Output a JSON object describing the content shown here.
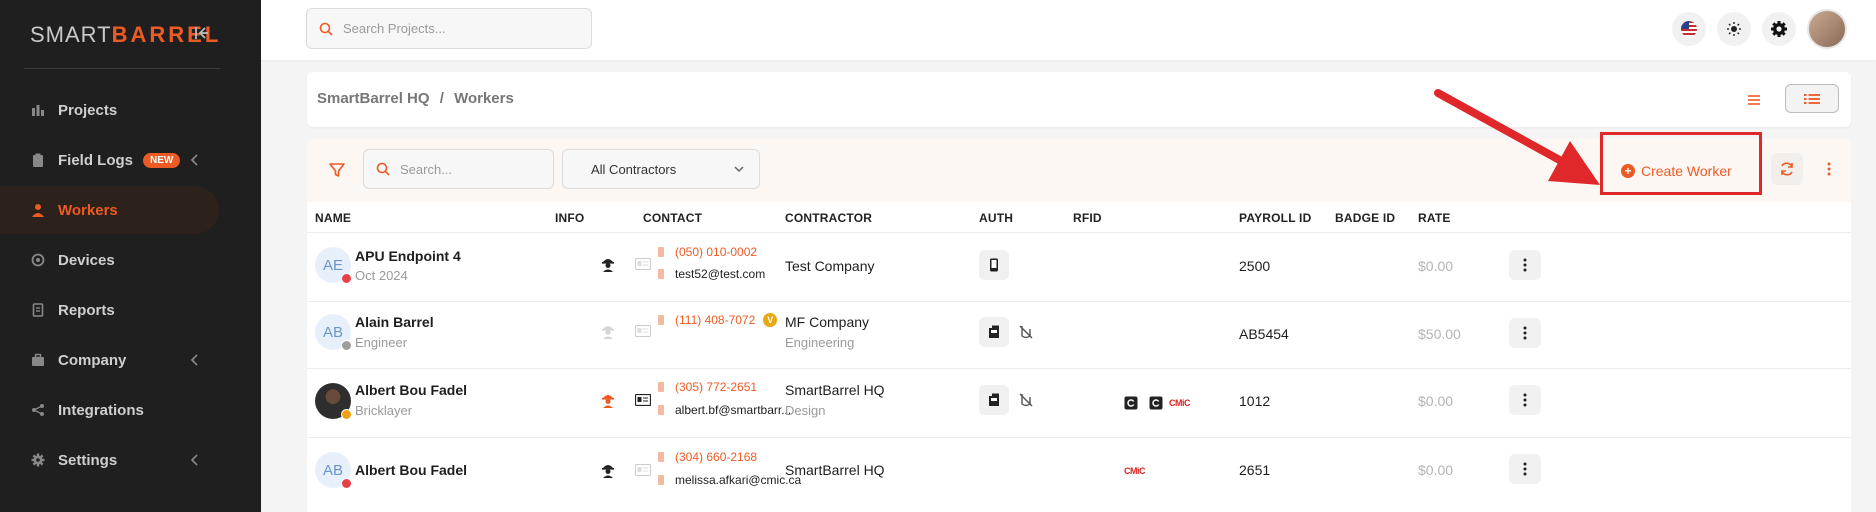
{
  "sidebar": {
    "logo_part1": "SMART",
    "logo_part2": "BARREL",
    "items": [
      {
        "label": "Projects"
      },
      {
        "label": "Field Logs",
        "badge": "NEW"
      },
      {
        "label": "Workers"
      },
      {
        "label": "Devices"
      },
      {
        "label": "Reports"
      },
      {
        "label": "Company"
      },
      {
        "label": "Integrations"
      },
      {
        "label": "Settings"
      }
    ]
  },
  "topbar": {
    "search_placeholder": "Search Projects..."
  },
  "breadcrumb": {
    "root": "SmartBarrel HQ",
    "separator": "/",
    "current": "Workers"
  },
  "filters": {
    "search_placeholder": "Search...",
    "contractor_select": "All Contractors",
    "create_label": "Create Worker"
  },
  "table": {
    "columns": [
      "NAME",
      "INFO",
      "CONTACT",
      "CONTRACTOR",
      "AUTH",
      "RFID",
      "PAYROLL ID",
      "BADGE ID",
      "RATE"
    ],
    "rows": [
      {
        "initials": "AE",
        "name": "APU Endpoint 4",
        "sub": "Oct 2024",
        "phone": "(050) 010-0002",
        "email": "test52@test.com",
        "contractor": "Test Company",
        "contractor_sub": "",
        "payroll": "2500",
        "badge": "",
        "rate": "$0.00"
      },
      {
        "initials": "AB",
        "name": "Alain Barrel",
        "sub": "Engineer",
        "phone": "(111) 408-7072",
        "phone_badge": "V",
        "email": "",
        "contractor": "MF Company",
        "contractor_sub": "Engineering",
        "payroll": "AB5454",
        "badge": "",
        "rate": "$50.00"
      },
      {
        "initials": "",
        "name": "Albert Bou Fadel",
        "sub": "Bricklayer",
        "phone": "(305) 772-2651",
        "email": "albert.bf@smartbarr...",
        "contractor": "SmartBarrel HQ",
        "contractor_sub": "Design",
        "rfid_label": "CMiC",
        "payroll": "1012",
        "badge": "",
        "rate": "$0.00"
      },
      {
        "initials": "AB",
        "name": "Albert Bou Fadel",
        "sub": "",
        "phone": "(304) 660-2168",
        "email": "melissa.afkari@cmic.ca",
        "contractor": "SmartBarrel HQ",
        "contractor_sub": "",
        "rfid_label": "CMiC",
        "payroll": "2651",
        "badge": "",
        "rate": "$0.00"
      }
    ]
  },
  "colors": {
    "accent": "#ec5b24",
    "sidebar_bg": "#1f1f1f",
    "highlight": "#e0282a",
    "status_red": "#e8404a",
    "status_gray": "#9e9e9e",
    "status_orange": "#f0a012"
  }
}
